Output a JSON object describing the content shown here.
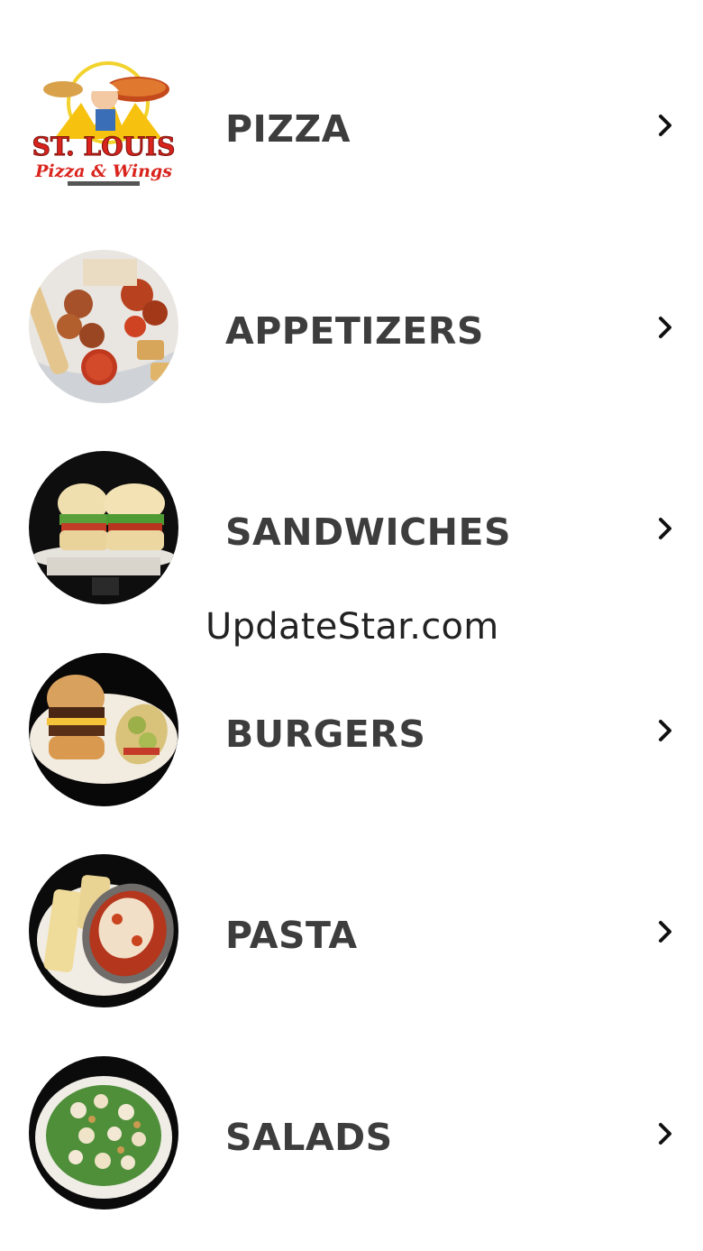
{
  "menu": {
    "items": [
      {
        "label": "PIZZA",
        "image": "st-louis-pizza-wings-logo"
      },
      {
        "label": "APPETIZERS",
        "image": "appetizers-platter-photo"
      },
      {
        "label": "SANDWICHES",
        "image": "sandwiches-photo"
      },
      {
        "label": "BURGERS",
        "image": "burger-plate-photo"
      },
      {
        "label": "PASTA",
        "image": "pasta-dish-photo"
      },
      {
        "label": "SALADS",
        "image": "salad-bowl-photo"
      }
    ],
    "chevron_icon": "chevron-right-icon"
  },
  "logo_text": {
    "line1": "ST. LOUIS",
    "line2": "Pizza & Wings"
  },
  "watermark": "UpdateStar.com",
  "colors": {
    "background": "#ffffff",
    "label": "#3d3d3d",
    "chevron": "#111111"
  }
}
